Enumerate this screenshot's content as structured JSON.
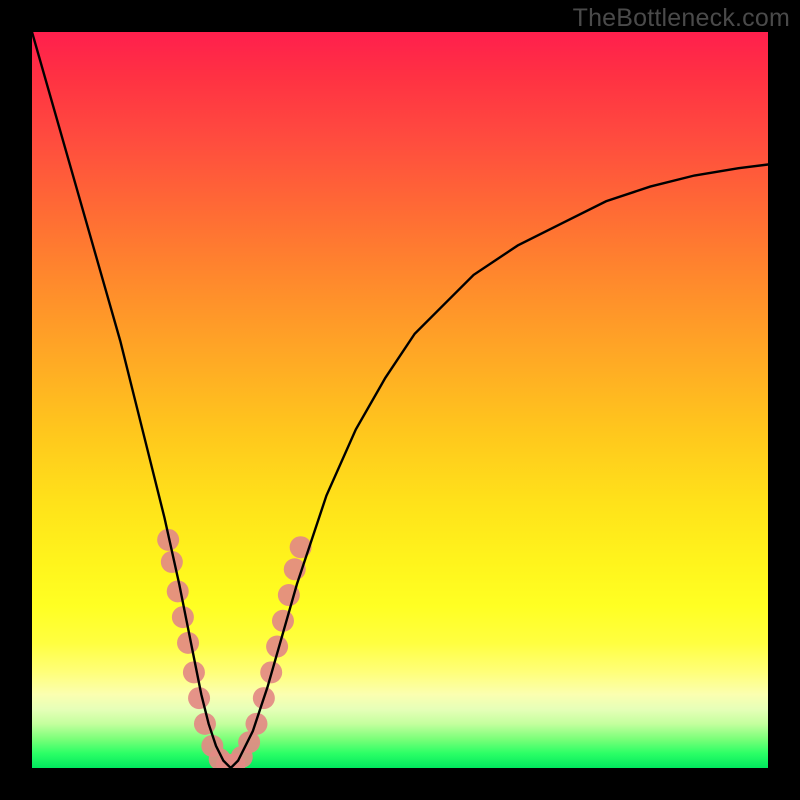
{
  "watermark": {
    "text": "TheBottleneck.com"
  },
  "chart_data": {
    "type": "line",
    "title": "",
    "xlabel": "",
    "ylabel": "",
    "xlim": [
      0,
      100
    ],
    "ylim": [
      0,
      100
    ],
    "grid": false,
    "legend": false,
    "series": [
      {
        "name": "bottleneck-curve",
        "x": [
          0,
          2,
          4,
          6,
          8,
          10,
          12,
          14,
          16,
          18,
          20,
          21,
          22,
          23,
          24,
          25,
          26,
          27,
          28,
          30,
          32,
          34,
          36,
          38,
          40,
          44,
          48,
          52,
          56,
          60,
          66,
          72,
          78,
          84,
          90,
          96,
          100
        ],
        "y": [
          100,
          93,
          86,
          79,
          72,
          65,
          58,
          50,
          42,
          34,
          25,
          20,
          15,
          10,
          6,
          3,
          1,
          0,
          1,
          5,
          11,
          18,
          25,
          31,
          37,
          46,
          53,
          59,
          63,
          67,
          71,
          74,
          77,
          79,
          80.5,
          81.5,
          82
        ],
        "color": "#000000"
      }
    ],
    "markers": {
      "name": "highlighted-points",
      "color": "#e38a84",
      "points": [
        {
          "x": 18.5,
          "y": 31
        },
        {
          "x": 19.0,
          "y": 28
        },
        {
          "x": 19.8,
          "y": 24
        },
        {
          "x": 20.5,
          "y": 20.5
        },
        {
          "x": 21.2,
          "y": 17
        },
        {
          "x": 22.0,
          "y": 13
        },
        {
          "x": 22.7,
          "y": 9.5
        },
        {
          "x": 23.5,
          "y": 6
        },
        {
          "x": 24.5,
          "y": 3
        },
        {
          "x": 25.5,
          "y": 1.2
        },
        {
          "x": 26.5,
          "y": 0.5
        },
        {
          "x": 27.5,
          "y": 0.5
        },
        {
          "x": 28.5,
          "y": 1.5
        },
        {
          "x": 29.5,
          "y": 3.5
        },
        {
          "x": 30.5,
          "y": 6
        },
        {
          "x": 31.5,
          "y": 9.5
        },
        {
          "x": 32.5,
          "y": 13
        },
        {
          "x": 33.3,
          "y": 16.5
        },
        {
          "x": 34.1,
          "y": 20
        },
        {
          "x": 34.9,
          "y": 23.5
        },
        {
          "x": 35.7,
          "y": 27
        },
        {
          "x": 36.5,
          "y": 30
        }
      ]
    }
  }
}
